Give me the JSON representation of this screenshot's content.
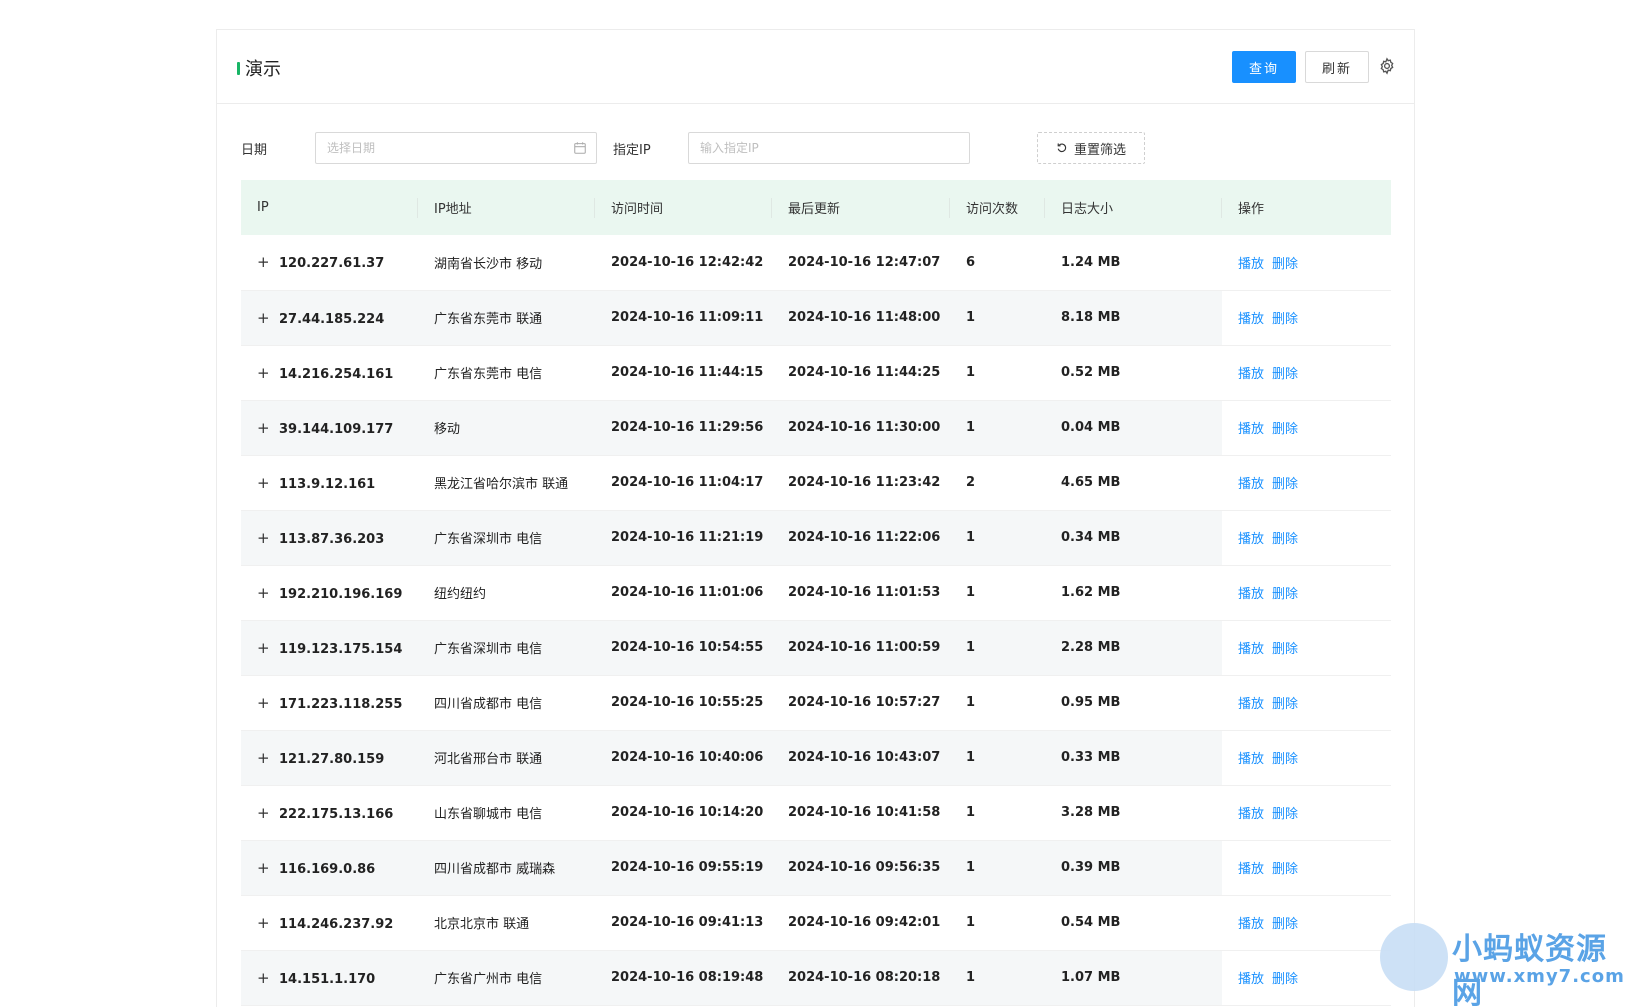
{
  "header": {
    "title": "演示",
    "query_label": "查询",
    "refresh_label": "刷新",
    "settings_icon": "gear-icon"
  },
  "filters": {
    "date_label": "日期",
    "date_placeholder": "选择日期",
    "ip_label": "指定IP",
    "ip_placeholder": "输入指定IP",
    "reset_label": "重置筛选"
  },
  "table": {
    "columns": [
      "IP",
      "IP地址",
      "访问时间",
      "最后更新",
      "访问次数",
      "日志大小",
      "操作"
    ],
    "play_label": "播放",
    "delete_label": "删除",
    "rows": [
      {
        "ip": "120.227.61.37",
        "location": "湖南省长沙市 移动",
        "visit_time": "2024-10-16 12:42:42",
        "last_update": "2024-10-16 12:47:07",
        "count": "6",
        "size": "1.24 MB"
      },
      {
        "ip": "27.44.185.224",
        "location": "广东省东莞市 联通",
        "visit_time": "2024-10-16 11:09:11",
        "last_update": "2024-10-16 11:48:00",
        "count": "1",
        "size": "8.18 MB"
      },
      {
        "ip": "14.216.254.161",
        "location": "广东省东莞市 电信",
        "visit_time": "2024-10-16 11:44:15",
        "last_update": "2024-10-16 11:44:25",
        "count": "1",
        "size": "0.52 MB"
      },
      {
        "ip": "39.144.109.177",
        "location": "移动",
        "visit_time": "2024-10-16 11:29:56",
        "last_update": "2024-10-16 11:30:00",
        "count": "1",
        "size": "0.04 MB"
      },
      {
        "ip": "113.9.12.161",
        "location": "黑龙江省哈尔滨市 联通",
        "visit_time": "2024-10-16 11:04:17",
        "last_update": "2024-10-16 11:23:42",
        "count": "2",
        "size": "4.65 MB"
      },
      {
        "ip": "113.87.36.203",
        "location": "广东省深圳市 电信",
        "visit_time": "2024-10-16 11:21:19",
        "last_update": "2024-10-16 11:22:06",
        "count": "1",
        "size": "0.34 MB"
      },
      {
        "ip": "192.210.196.169",
        "location": "纽约纽约",
        "visit_time": "2024-10-16 11:01:06",
        "last_update": "2024-10-16 11:01:53",
        "count": "1",
        "size": "1.62 MB"
      },
      {
        "ip": "119.123.175.154",
        "location": "广东省深圳市 电信",
        "visit_time": "2024-10-16 10:54:55",
        "last_update": "2024-10-16 11:00:59",
        "count": "1",
        "size": "2.28 MB"
      },
      {
        "ip": "171.223.118.255",
        "location": "四川省成都市 电信",
        "visit_time": "2024-10-16 10:55:25",
        "last_update": "2024-10-16 10:57:27",
        "count": "1",
        "size": "0.95 MB"
      },
      {
        "ip": "121.27.80.159",
        "location": "河北省邢台市 联通",
        "visit_time": "2024-10-16 10:40:06",
        "last_update": "2024-10-16 10:43:07",
        "count": "1",
        "size": "0.33 MB"
      },
      {
        "ip": "222.175.13.166",
        "location": "山东省聊城市 电信",
        "visit_time": "2024-10-16 10:14:20",
        "last_update": "2024-10-16 10:41:58",
        "count": "1",
        "size": "3.28 MB"
      },
      {
        "ip": "116.169.0.86",
        "location": "四川省成都市 威瑞森",
        "visit_time": "2024-10-16 09:55:19",
        "last_update": "2024-10-16 09:56:35",
        "count": "1",
        "size": "0.39 MB"
      },
      {
        "ip": "114.246.237.92",
        "location": "北京北京市 联通",
        "visit_time": "2024-10-16 09:41:13",
        "last_update": "2024-10-16 09:42:01",
        "count": "1",
        "size": "0.54 MB"
      },
      {
        "ip": "14.151.1.170",
        "location": "广东省广州市 电信",
        "visit_time": "2024-10-16 08:19:48",
        "last_update": "2024-10-16 08:20:18",
        "count": "1",
        "size": "1.07 MB"
      }
    ]
  },
  "watermark": {
    "name": "小蚂蚁资源网",
    "url": "www.xmy7.com"
  },
  "colors": {
    "primary": "#1890ff",
    "accent_green": "#18b566",
    "header_bg": "#eaf7f0"
  }
}
